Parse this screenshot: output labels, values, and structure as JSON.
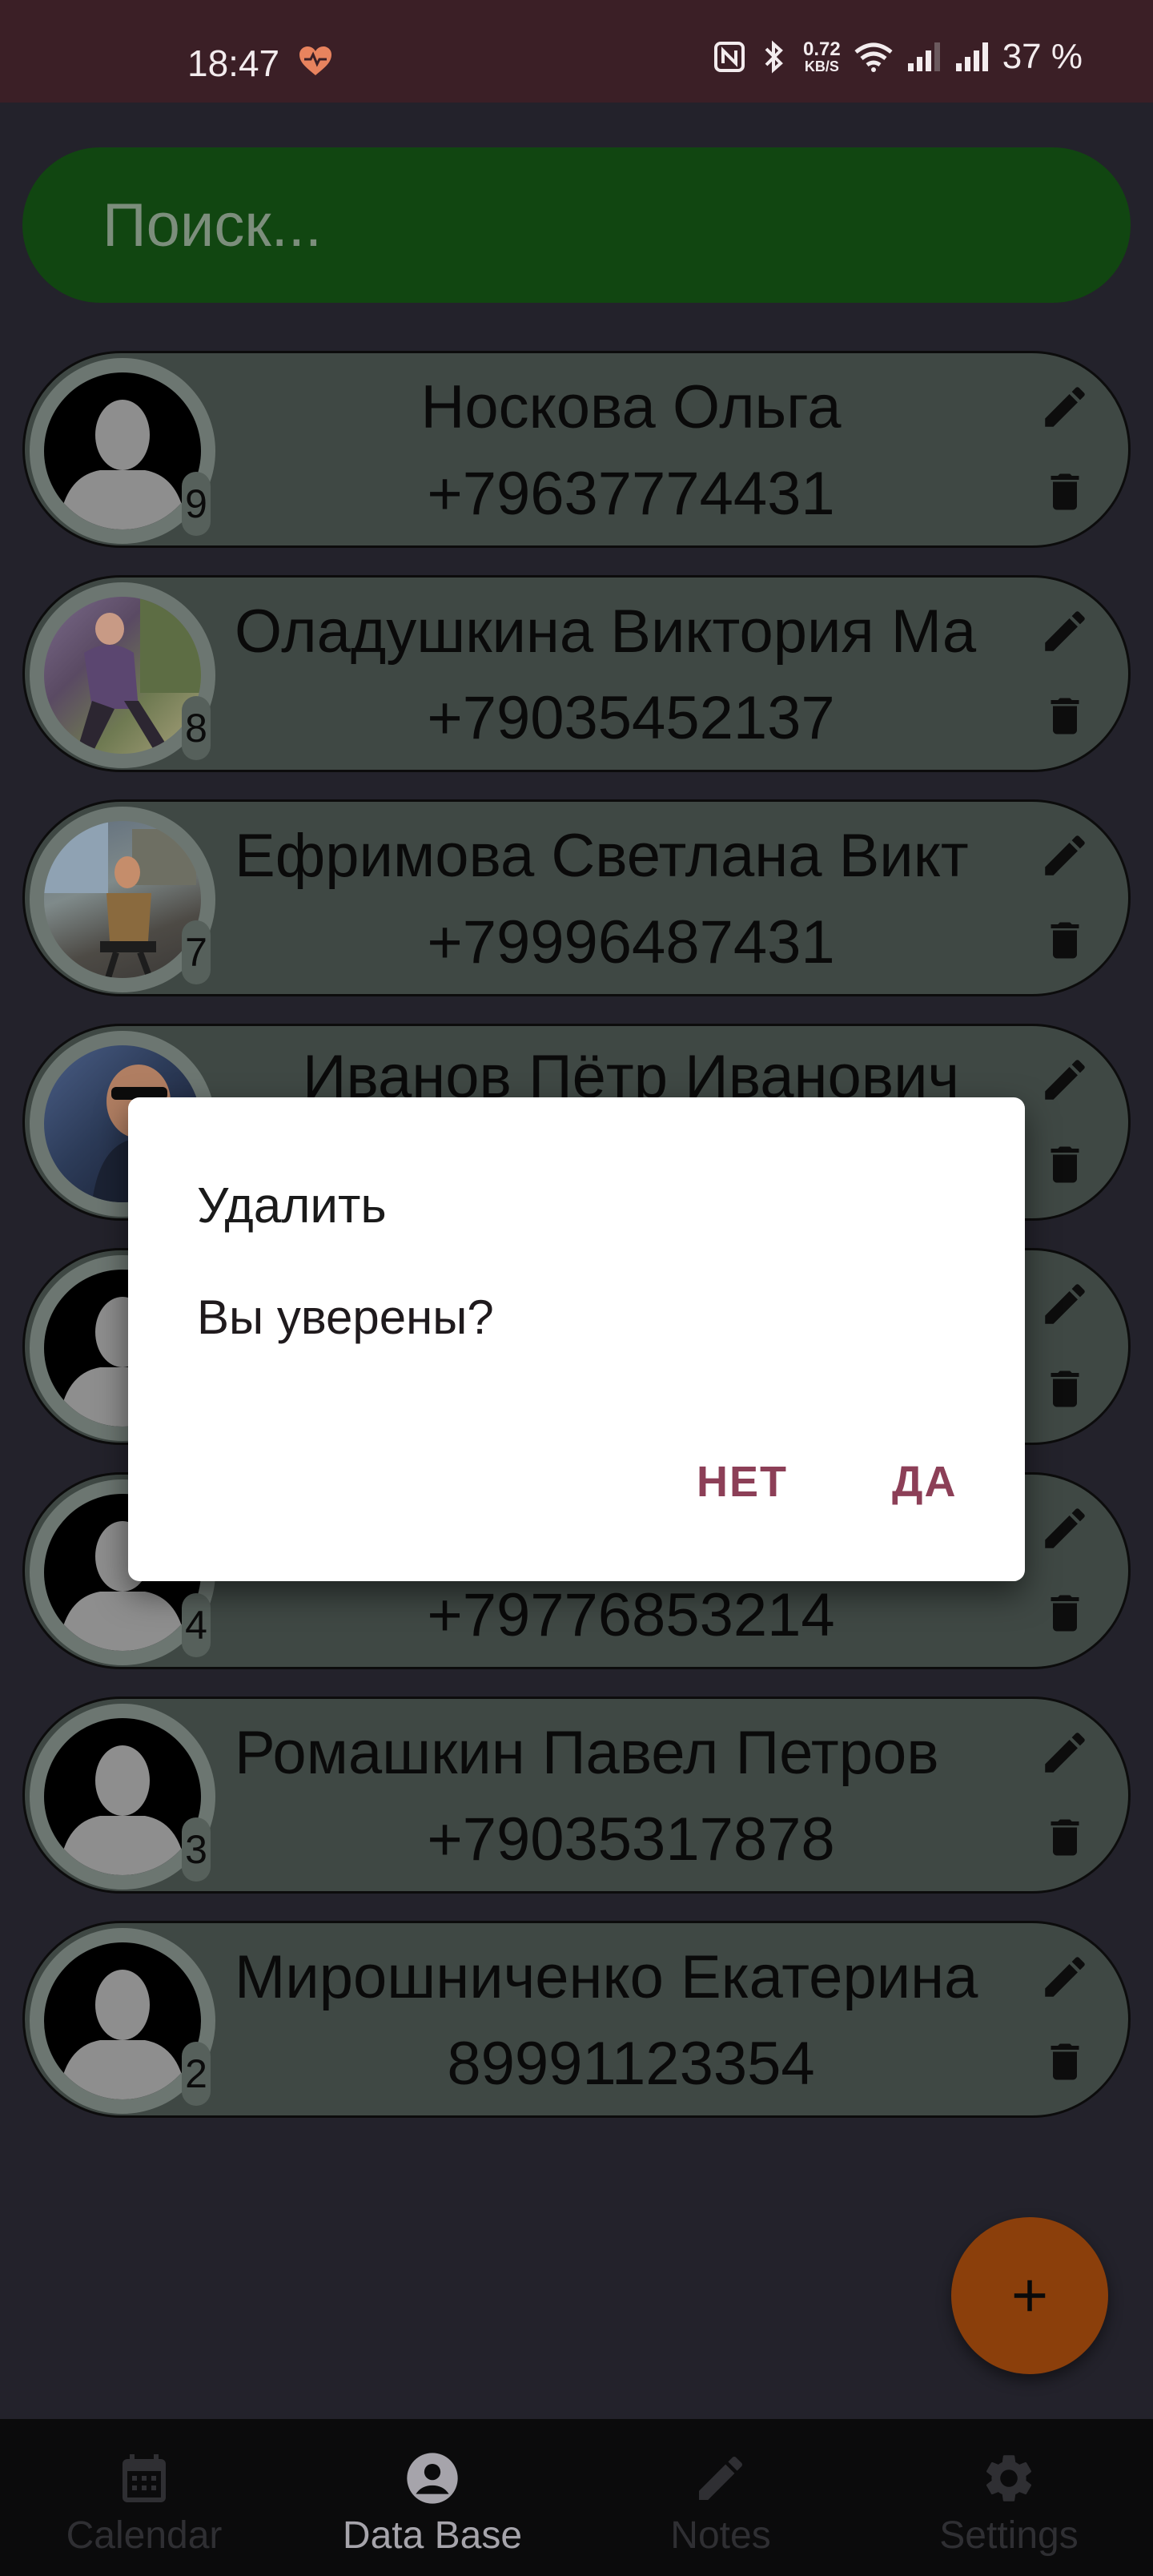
{
  "status_bar": {
    "time": "18:47",
    "net_speed_top": "0.72",
    "net_speed_bottom": "KB/S",
    "battery": "37 %"
  },
  "search": {
    "placeholder": "Поиск..."
  },
  "contacts": [
    {
      "name": "Носкова Ольга",
      "phone": "+79637774431",
      "badge": "9",
      "avatar": "default"
    },
    {
      "name": "Оладушкина Виктория Ма",
      "phone": "+79035452137",
      "badge": "8",
      "avatar": "photo"
    },
    {
      "name": "Ефримова Светлана  Викт",
      "phone": "+79996487431",
      "badge": "7",
      "avatar": "photo"
    },
    {
      "name": "Иванов Пётр  Иванович",
      "phone": "",
      "badge": "",
      "avatar": "photo"
    },
    {
      "name": "",
      "phone": "",
      "badge": "",
      "avatar": "default"
    },
    {
      "name": "",
      "phone": "+79776853214",
      "badge": "4",
      "avatar": "default"
    },
    {
      "name": "Ромашкин Павел  Петров",
      "phone": "+79035317878",
      "badge": "3",
      "avatar": "default"
    },
    {
      "name": "Мирошниченко Екатерина",
      "phone": "89991123354",
      "badge": "2",
      "avatar": "default"
    }
  ],
  "dialog": {
    "title": "Удалить",
    "message": "Вы уверены?",
    "no_label": "НЕТ",
    "yes_label": "ДА"
  },
  "fab": {
    "icon": "plus-icon"
  },
  "bottom_nav": [
    {
      "label": "Calendar",
      "icon": "calendar-icon",
      "active": false
    },
    {
      "label": "Data Base",
      "icon": "account-icon",
      "active": true
    },
    {
      "label": "Notes",
      "icon": "pencil-icon",
      "active": false
    },
    {
      "label": "Settings",
      "icon": "gear-icon",
      "active": false
    }
  ],
  "colors": {
    "status_bar": "#3b1f26",
    "search_bg": "#114611",
    "contact_bg": "#3f4844",
    "dialog_button": "#8c3f57",
    "fab": "#8b3f0b"
  }
}
